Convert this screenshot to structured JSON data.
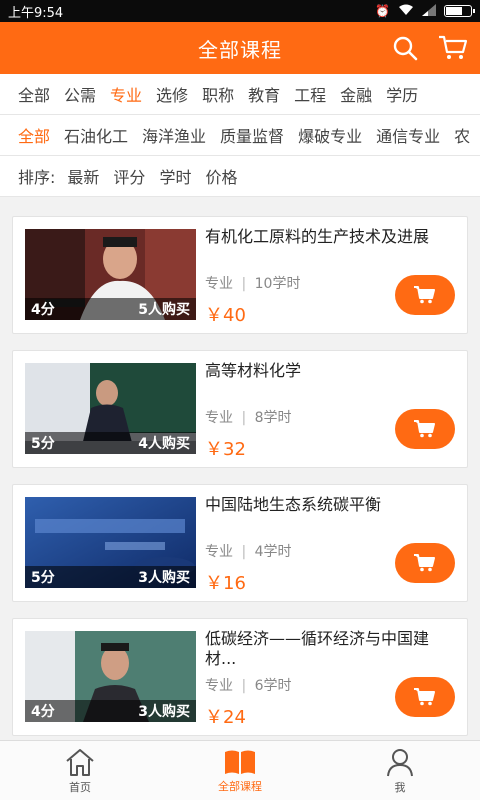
{
  "status": {
    "time": "上午9:54"
  },
  "header": {
    "title": "全部课程"
  },
  "filters": {
    "categories": [
      "全部",
      "公需",
      "专业",
      "选修",
      "职称",
      "教育",
      "工程",
      "金融",
      "学历"
    ],
    "subcategories": [
      "全部",
      "石油化工",
      "海洋渔业",
      "质量监督",
      "爆破专业",
      "通信专业",
      "农"
    ],
    "sort_label": "排序:",
    "sort_options": [
      "最新",
      "评分",
      "学时",
      "价格"
    ]
  },
  "courses": [
    {
      "title": "有机化工原料的生产技术及进展",
      "rating": "4分",
      "buyers": "5人购买",
      "category": "专业",
      "hours": "10学时",
      "price": "￥40"
    },
    {
      "title": "高等材料化学",
      "rating": "5分",
      "buyers": "4人购买",
      "category": "专业",
      "hours": "8学时",
      "price": "￥32"
    },
    {
      "title": "中国陆地生态系统碳平衡",
      "rating": "5分",
      "buyers": "3人购买",
      "category": "专业",
      "hours": "4学时",
      "price": "￥16"
    },
    {
      "title": "低碳经济——循环经济与中国建材...",
      "rating": "4分",
      "buyers": "3人购买",
      "category": "专业",
      "hours": "6学时",
      "price": "￥24"
    }
  ],
  "meta_separator": "|",
  "tabs": [
    {
      "label": "首页",
      "icon": "home-icon"
    },
    {
      "label": "全部课程",
      "icon": "book-icon"
    },
    {
      "label": "我",
      "icon": "user-icon"
    }
  ],
  "colors": {
    "accent": "#ff6a13"
  }
}
